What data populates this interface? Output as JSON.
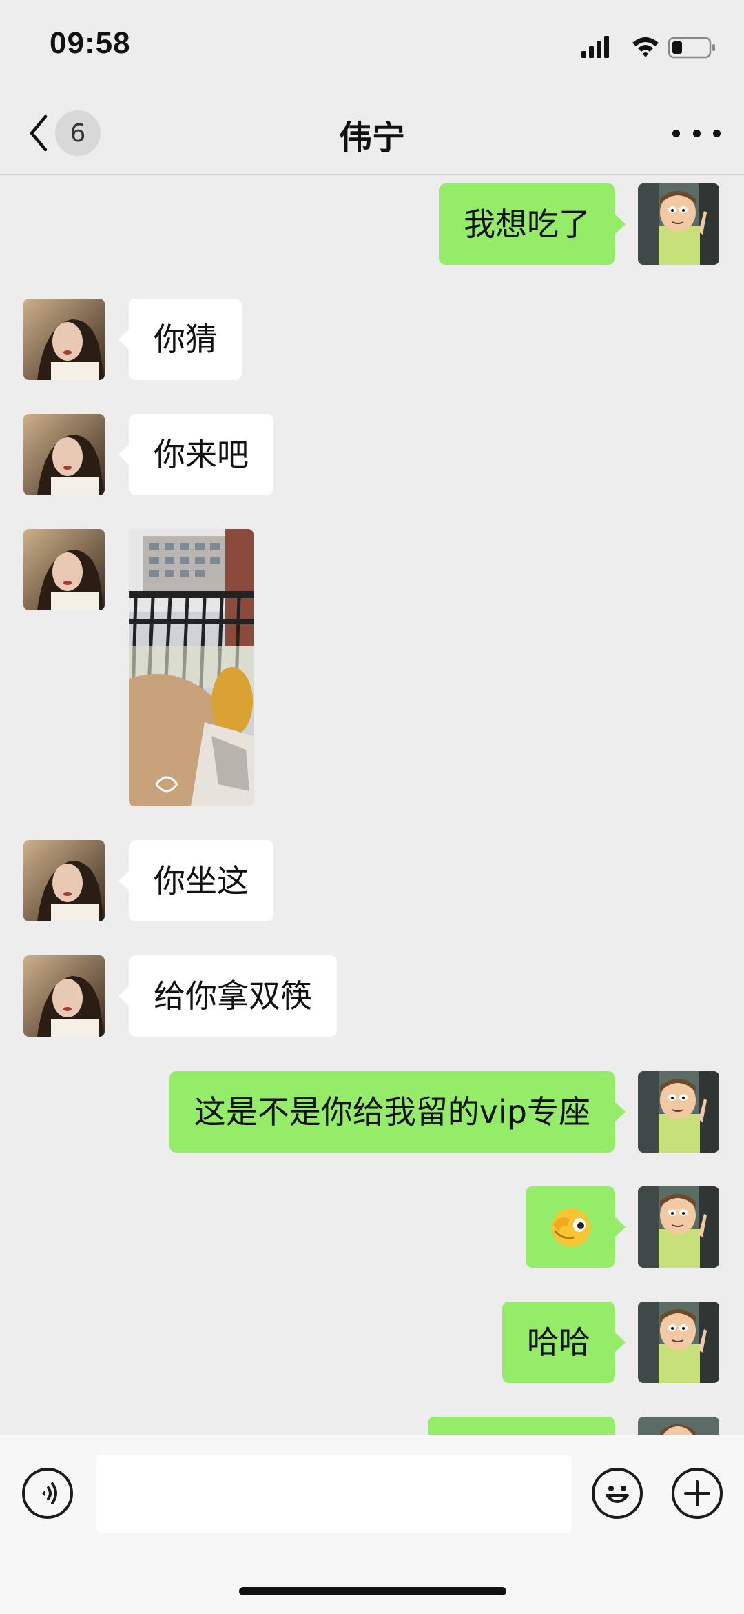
{
  "status_bar": {
    "time": "09:58",
    "icons": [
      "signal-icon",
      "wifi-icon",
      "battery-icon"
    ]
  },
  "nav": {
    "back_badge": "6",
    "title": "伟宁",
    "more_icon": "more-icon"
  },
  "messages": [
    {
      "side": "out",
      "type": "text",
      "text": "我想吃了"
    },
    {
      "side": "in",
      "type": "text",
      "text": "你猜"
    },
    {
      "side": "in",
      "type": "text",
      "text": "你来吧"
    },
    {
      "side": "in",
      "type": "image",
      "description_icon": "photo-balcony"
    },
    {
      "side": "in",
      "type": "text",
      "text": "你坐这"
    },
    {
      "side": "in",
      "type": "text",
      "text": "给你拿双筷"
    },
    {
      "side": "out",
      "type": "text",
      "text": "这是不是你给我留的vip专座"
    },
    {
      "side": "out",
      "type": "emoji",
      "text": "",
      "icon": "facepalm-emoji-icon"
    },
    {
      "side": "out",
      "type": "text",
      "text": "哈哈"
    },
    {
      "side": "out",
      "type": "text",
      "text": ""
    }
  ],
  "input_bar": {
    "text_value": "",
    "left_icon": "voice-icon",
    "emoji_icon": "emoji-icon",
    "plus_icon": "plus-icon"
  },
  "colors": {
    "outgoing_bubble": "#95ec69",
    "incoming_bubble": "#ffffff",
    "background": "#ededed"
  }
}
